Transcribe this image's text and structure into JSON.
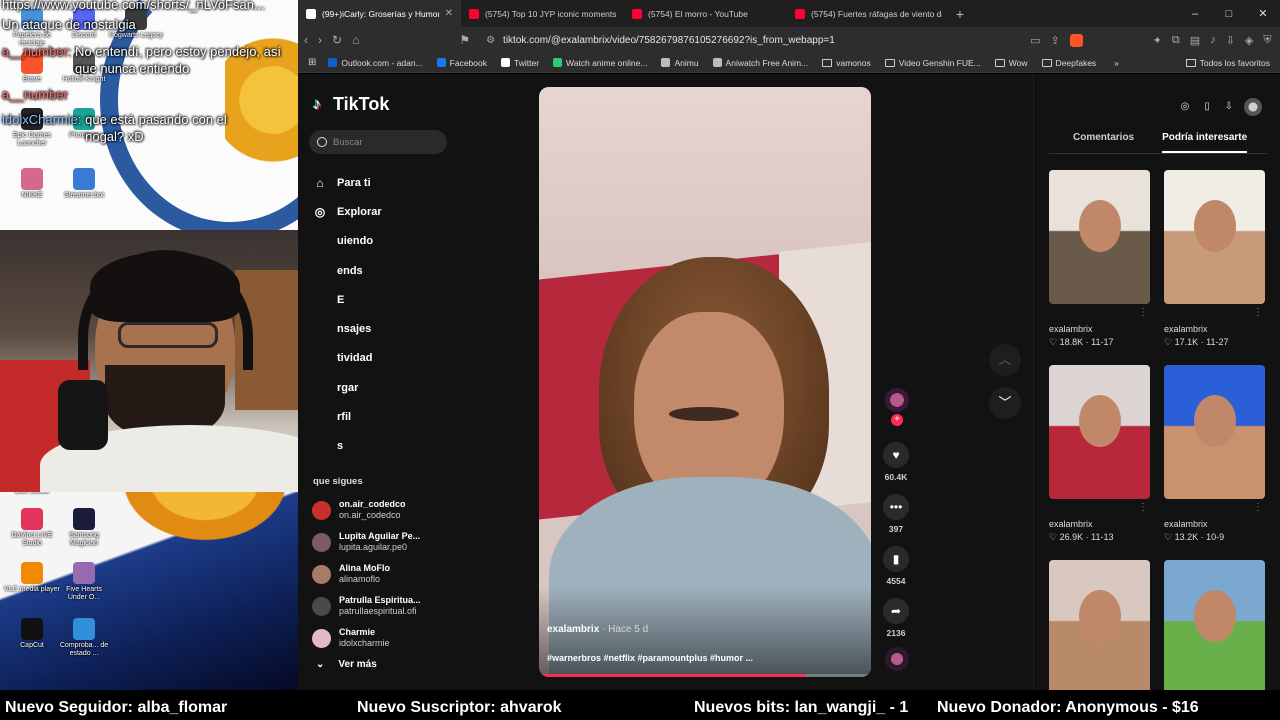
{
  "desktop": {
    "icons": [
      {
        "label": "Papelera de reciclaje",
        "color": "#4a90d9"
      },
      {
        "label": "Discord",
        "color": "#5865f2"
      },
      {
        "label": "Hogwarts Legacy",
        "color": "#3a3a3a"
      },
      {
        "label": "Brave",
        "color": "#fb542b"
      },
      {
        "label": "Hollow Knight",
        "color": "#555555"
      },
      {
        "label": "Epic Games Launcher",
        "color": "#222222"
      },
      {
        "label": "Photopea",
        "color": "#18a497"
      },
      {
        "label": "NIKKE",
        "color": "#d46a8a"
      },
      {
        "label": "Streamer.bot",
        "color": "#3a7bd5"
      },
      {
        "label": "Obs Studio",
        "color": "#302e31"
      },
      {
        "label": "DaVinci LIVE Studio",
        "color": "#e4335b"
      },
      {
        "label": "Samsung Magician",
        "color": "#1b1b3a"
      },
      {
        "label": "VLC media player",
        "color": "#f08a00"
      },
      {
        "label": "Five Hearts Under O...",
        "color": "#9a6ab0"
      },
      {
        "label": "CapCut",
        "color": "#111111"
      },
      {
        "label": "Comproba... de estado ...",
        "color": "#2f8fd9"
      }
    ]
  },
  "chat": {
    "url_fragment": "https://www.youtube.com/shorts/_nLVoFsan...",
    "lines": [
      {
        "user": "",
        "text": "Un ataque de nostalgia"
      },
      {
        "user": "a__number:",
        "text": "No entendí, pero estoy pendejo, así que nunca entiendo"
      },
      {
        "user": "a__number",
        "text": ""
      },
      {
        "user": "idolxCharmie:",
        "text": "que está pasando con el nogal? xD"
      }
    ]
  },
  "browser": {
    "tabs": [
      {
        "title": "(99+)iCarly: Groserías y Humor d...",
        "favicon": "tiktok",
        "active": true
      },
      {
        "title": "(5754) Top 10 JYP iconic moments #j...",
        "favicon": "youtube",
        "active": false
      },
      {
        "title": "(5754) El morro - YouTube",
        "favicon": "youtube",
        "active": false
      },
      {
        "title": "(5754) Fuertes ráfagas de viento dem...",
        "favicon": "youtube",
        "active": false
      }
    ],
    "new_tab": "+",
    "window_controls": [
      "–",
      "□",
      "✕"
    ],
    "url": "tiktok.com/@exalambrix/video/7582679876105276692?is_from_webapp=1",
    "bookmarks": [
      {
        "label": "Outlook.com - adan...",
        "icon": "outlook-icon",
        "color": "#0a64d0"
      },
      {
        "label": "Facebook",
        "icon": "facebook-icon",
        "color": "#1877f2"
      },
      {
        "label": "Twitter",
        "icon": "x-icon",
        "color": "#ffffff"
      },
      {
        "label": "Watch anime online...",
        "icon": "anime-icon",
        "color": "#2ecc71"
      },
      {
        "label": "Animu",
        "icon": "animu-icon",
        "color": "#bbbbbb"
      },
      {
        "label": "Aniwatch Free Anim...",
        "icon": "aniwatch-icon",
        "color": "#bbbbbb"
      },
      {
        "label": "vamonos",
        "icon": "folder-icon",
        "color": ""
      },
      {
        "label": "Video Genshin FUE...",
        "icon": "folder-icon",
        "color": ""
      },
      {
        "label": "Wow",
        "icon": "folder-icon",
        "color": ""
      },
      {
        "label": "Deepfakes",
        "icon": "folder-icon",
        "color": ""
      }
    ],
    "bookmarks_more": "»",
    "all_bookmarks": "Todos los favoritos"
  },
  "tiktok": {
    "logo_text": "TikTok",
    "search_placeholder": "Buscar",
    "nav": [
      {
        "label": "Para ti",
        "icon": "home-icon",
        "glyph": "⌂"
      },
      {
        "label": "Explorar",
        "icon": "compass-icon",
        "glyph": "◎"
      },
      {
        "label": "uiendo",
        "icon": "following-icon",
        "glyph": ""
      },
      {
        "label": "ends",
        "icon": "friends-icon",
        "glyph": ""
      },
      {
        "label": "E",
        "icon": "live-icon",
        "glyph": ""
      },
      {
        "label": "nsajes",
        "icon": "messages-icon",
        "glyph": ""
      },
      {
        "label": "tividad",
        "icon": "activity-icon",
        "glyph": ""
      },
      {
        "label": "rgar",
        "icon": "upload-icon",
        "glyph": ""
      },
      {
        "label": "rfil",
        "icon": "profile-icon",
        "glyph": ""
      },
      {
        "label": "s",
        "icon": "more-icon",
        "glyph": ""
      }
    ],
    "following_title": "que sigues",
    "following": [
      {
        "name": "on.air_codedco",
        "handle": "on.air_codedco",
        "color": "#c9302c"
      },
      {
        "name": "Lupita Aguilar Pe...",
        "handle": "lupita.aguilar.pe0",
        "color": "#7a5a6a"
      },
      {
        "name": "Alina MoFlo",
        "handle": "alinamoflo",
        "color": "#a87a6a"
      },
      {
        "name": "Patrulla Espiritua...",
        "handle": "patrullaespiritual.ofi",
        "color": "#4a4a4a"
      },
      {
        "name": "Charmie",
        "handle": "idolxcharmie",
        "color": "#e6b7c8"
      }
    ],
    "see_more": "Ver más",
    "video": {
      "username": "exalambrix",
      "ago": "· Hace 5 d",
      "hashtags": "#warnerbros #netflix #paramountplus #humor ...",
      "progress": 0.8
    },
    "actions": {
      "likes": "60.4K",
      "comments": "397",
      "saves": "4554",
      "shares": "2136"
    },
    "right_tabs": [
      "Comentarios",
      "Podría interesarte"
    ],
    "suggested": [
      {
        "user": "exalambrix",
        "likes": "18.8K",
        "date": "11-17",
        "c1": "#e8e2da",
        "c2": "#6a5a4a"
      },
      {
        "user": "exalambrix",
        "likes": "17.1K",
        "date": "11-27",
        "c1": "#f0ece6",
        "c2": "#c99a7a"
      },
      {
        "user": "exalambrix",
        "likes": "26.9K",
        "date": "11-13",
        "c1": "#dcd4d2",
        "c2": "#b8283a"
      },
      {
        "user": "exalambrix",
        "likes": "13.2K",
        "date": "10-9",
        "c1": "#2a5fd8",
        "c2": "#c9926e"
      },
      {
        "user": "",
        "likes": "",
        "date": "",
        "c1": "#d8c8c0",
        "c2": "#b88a6a"
      },
      {
        "user": "",
        "likes": "",
        "date": "",
        "c1": "#7aa8d0",
        "c2": "#6ab04a"
      }
    ]
  },
  "ticker": {
    "follower": "Nuevo Seguidor: alba_flomar",
    "subscriber": "Nuevo Suscriptor: ahvarok",
    "bits": "Nuevos bits: lan_wangji_ - 1",
    "donation": "Nuevo Donador: Anonymous - $16"
  }
}
